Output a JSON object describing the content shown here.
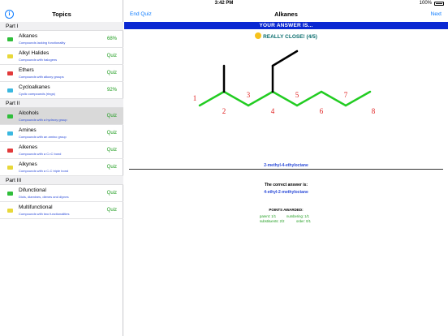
{
  "statusbar": {
    "carrier": "iPad",
    "time": "3:42 PM",
    "battery": "100%"
  },
  "sidebar": {
    "title": "Topics",
    "sections": [
      {
        "label": "Part I",
        "rows": [
          {
            "name": "Alkanes",
            "sub": "Compounds lacking functionality",
            "right": "68%",
            "icon_color": "#2fbe3a"
          },
          {
            "name": "Alkyl Halides",
            "sub": "Compounds with halogens",
            "right": "Quiz",
            "icon_color": "#e8d83a"
          },
          {
            "name": "Ethers",
            "sub": "Compounds with alkoxy groups",
            "right": "Quiz",
            "icon_color": "#e23a3a"
          },
          {
            "name": "Cycloalkanes",
            "sub": "Cyclic compounds (rings)",
            "right": "92%",
            "icon_color": "#3ab8e0"
          }
        ]
      },
      {
        "label": "Part II",
        "rows": [
          {
            "name": "Alcohols",
            "sub": "Compounds with a hydroxy group",
            "right": "Quiz",
            "icon_color": "#2fbe3a"
          },
          {
            "name": "Amines",
            "sub": "Compounds with an amino group",
            "right": "Quiz",
            "icon_color": "#3ab8e0"
          },
          {
            "name": "Alkenes",
            "sub": "Compounds with a C=C bond",
            "right": "Quiz",
            "icon_color": "#e23a3a"
          },
          {
            "name": "Alkynes",
            "sub": "Compounds with a C-C triple bond",
            "right": "Quiz",
            "icon_color": "#e8d83a"
          }
        ]
      },
      {
        "label": "Part III",
        "rows": [
          {
            "name": "Difunctional",
            "sub": "Diols, diamines, dienes and diynes",
            "right": "Quiz",
            "icon_color": "#2fbe3a"
          },
          {
            "name": "Multifunctional",
            "sub": "Compounds with two functionalities",
            "right": "Quiz",
            "icon_color": "#e8d83a"
          }
        ]
      }
    ]
  },
  "navbar": {
    "left": "End Quiz",
    "title": "Alkanes",
    "right": "Next"
  },
  "banner": "YOUR ANSWER IS...",
  "result": "REALLY CLOSE! (4/5)",
  "molecule": {
    "numbers": [
      "1",
      "2",
      "3",
      "4",
      "5",
      "6",
      "7",
      "8"
    ],
    "bond_color": "#22cc22",
    "branch_color": "#000000",
    "number_color": "#e02020"
  },
  "user_answer": "2-methyl-4-ethyloctane",
  "correct_label": "The correct answer is:",
  "correct_answer": "4-ethyl-2-methyloctane",
  "points": {
    "label": "POINTS AWARDED:",
    "parent": "parent: 1/1",
    "numbering": "numbering: 1/1",
    "substituents": "substituents: 2/2",
    "order": "order: 0/1"
  }
}
